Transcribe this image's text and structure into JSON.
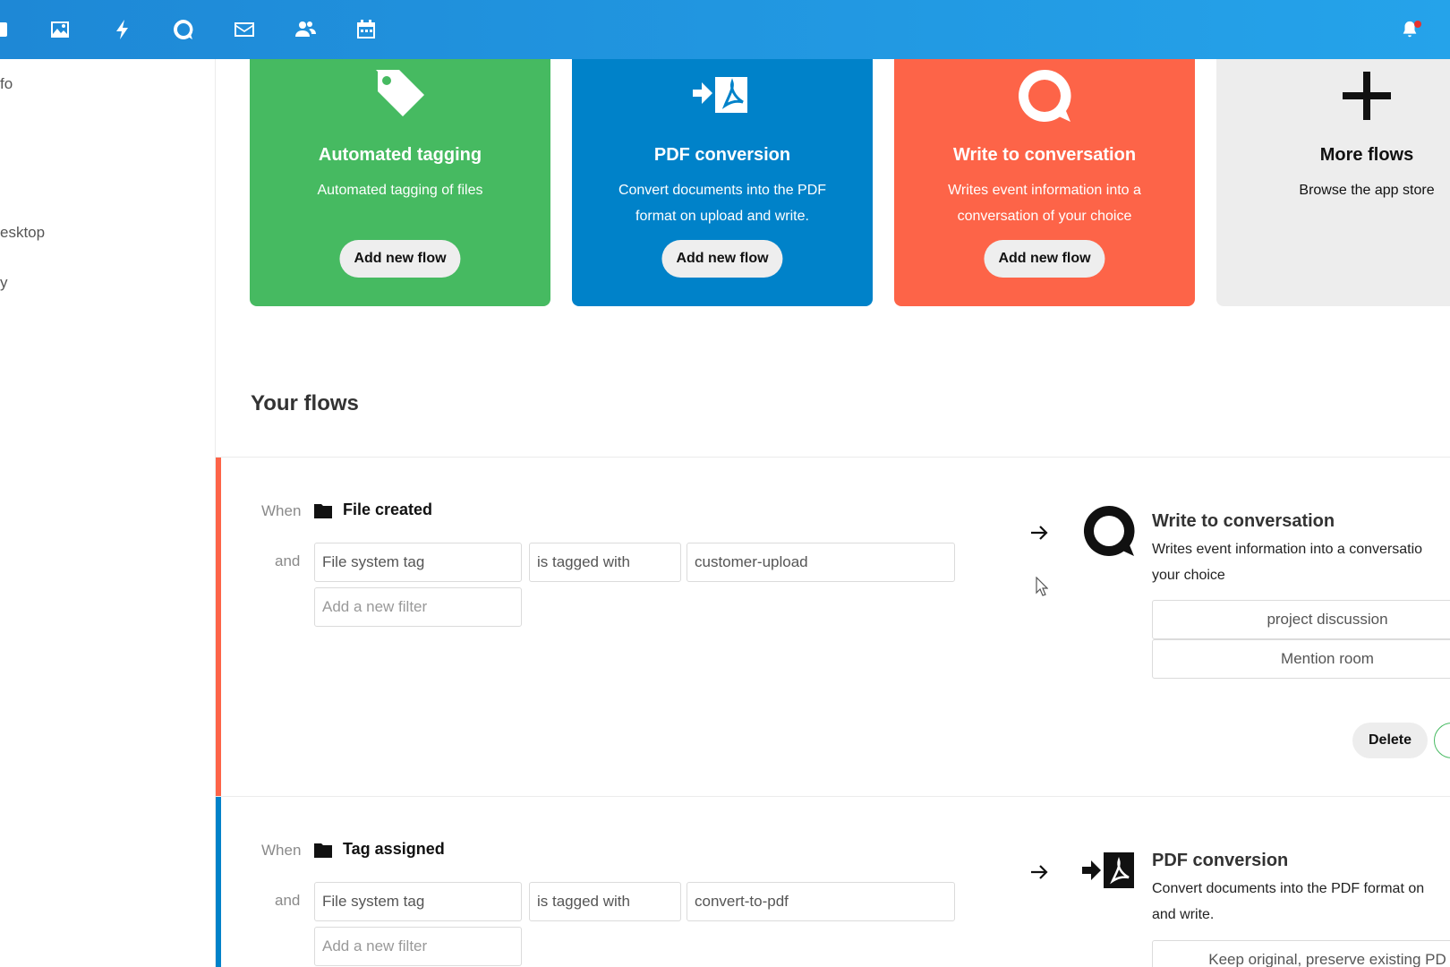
{
  "topbar": {
    "icons": [
      "files-icon",
      "photos-icon",
      "activity-icon",
      "talk-icon",
      "mail-icon",
      "contacts-icon",
      "calendar-icon"
    ],
    "notification_icon": "bell-icon"
  },
  "sidebar": {
    "items": [
      {
        "label": "fo"
      },
      {
        "label": "esktop"
      },
      {
        "label": "y"
      }
    ]
  },
  "templates": [
    {
      "title": "Automated tagging",
      "desc_lines": [
        "Automated tagging of files"
      ],
      "button": "Add new flow",
      "color": "#46ba61",
      "icon": "tag-icon"
    },
    {
      "title": "PDF conversion",
      "desc_lines": [
        "Convert documents into the PDF",
        "format on upload and write."
      ],
      "button": "Add new flow",
      "color": "#0082c9",
      "icon": "pdf-convert-icon"
    },
    {
      "title": "Write to conversation",
      "desc_lines": [
        "Writes event information into a",
        "conversation of your choice"
      ],
      "button": "Add new flow",
      "color": "#fd6448",
      "icon": "talk-icon"
    },
    {
      "title": "More flows",
      "desc_lines": [
        "Browse the app store"
      ],
      "color": "#ededed",
      "icon": "plus-icon"
    }
  ],
  "section_title": "Your flows",
  "flows": [
    {
      "accent": "#fd6448",
      "when_label": "When",
      "event": "File created",
      "and_label": "and",
      "filter": {
        "property": "File system tag",
        "operator": "is tagged with",
        "value": "customer-upload"
      },
      "add_filter_placeholder": "Add a new filter",
      "operation": {
        "title": "Write to conversation",
        "desc_lines": [
          "Writes event information into a conversatio",
          "your choice"
        ],
        "options": [
          "project discussion",
          "Mention room"
        ]
      },
      "delete_label": "Delete"
    },
    {
      "accent": "#0082c9",
      "when_label": "When",
      "event": "Tag assigned",
      "and_label": "and",
      "filter": {
        "property": "File system tag",
        "operator": "is tagged with",
        "value": "convert-to-pdf"
      },
      "add_filter_placeholder": "Add a new filter",
      "operation": {
        "title": "PDF conversion",
        "desc_lines": [
          "Convert documents into the PDF format on",
          "and write."
        ],
        "options": [
          "Keep original, preserve existing PD"
        ]
      }
    }
  ]
}
